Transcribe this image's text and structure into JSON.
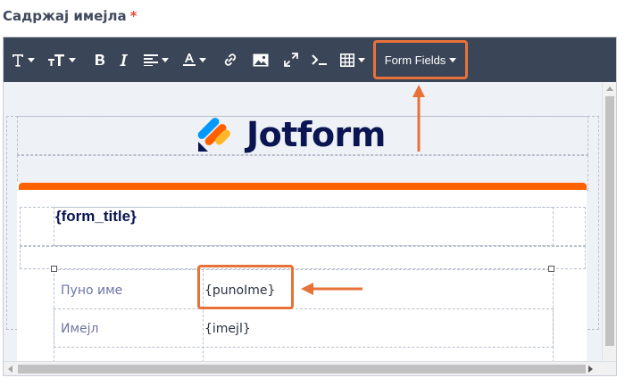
{
  "field": {
    "label": "Садржај имејла",
    "required_mark": "*"
  },
  "toolbar": {
    "form_fields_label": "Form Fields",
    "items": [
      "font-family",
      "font-size",
      "bold",
      "italic",
      "align",
      "font-color",
      "link",
      "image",
      "fullscreen",
      "source-code",
      "table"
    ]
  },
  "email": {
    "brand_name": "Jotform",
    "form_title_placeholder": "{form_title}",
    "rows": [
      {
        "label": "Пуно име",
        "value": "{punoIme}"
      },
      {
        "label": "Имејл",
        "value": "{imejl}"
      }
    ]
  },
  "colors": {
    "toolbar": "#3a4557",
    "highlight": "#e8713a",
    "brand_orange": "#ff6100",
    "brand_navy": "#0a1551"
  }
}
